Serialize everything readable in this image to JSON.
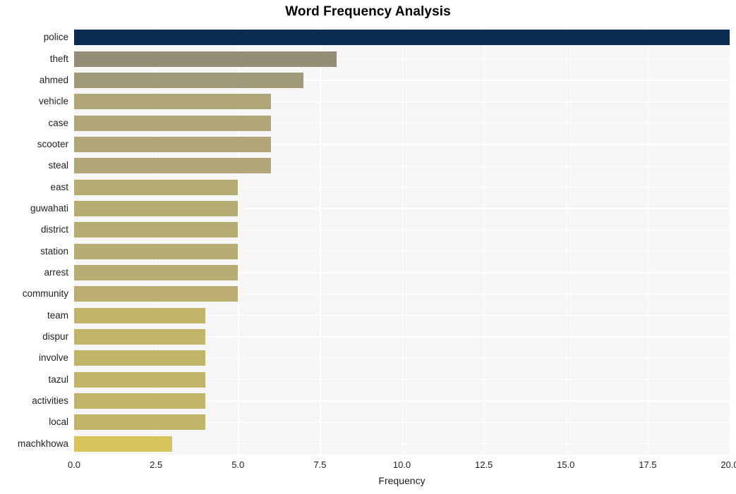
{
  "chart_data": {
    "type": "bar",
    "orientation": "horizontal",
    "title": "Word Frequency Analysis",
    "xlabel": "Frequency",
    "ylabel": "",
    "categories": [
      "police",
      "theft",
      "ahmed",
      "vehicle",
      "case",
      "scooter",
      "steal",
      "east",
      "guwahati",
      "district",
      "station",
      "arrest",
      "community",
      "team",
      "dispur",
      "involve",
      "tazul",
      "activities",
      "local",
      "machkhowa"
    ],
    "values": [
      20,
      8,
      7,
      6,
      6,
      6,
      6,
      5,
      5,
      5,
      5,
      5,
      5,
      4,
      4,
      4,
      4,
      4,
      4,
      3
    ],
    "bar_colors": [
      "#0b2a52",
      "#938c77",
      "#a09a79",
      "#b0a677",
      "#b0a677",
      "#b0a677",
      "#b0a677",
      "#b7ac74",
      "#b7ac74",
      "#b7ac74",
      "#b7ac74",
      "#b7ac74",
      "#bcae72",
      "#c2b56a",
      "#c2b56a",
      "#c2b56a",
      "#c2b56a",
      "#c2b56a",
      "#c2b56a",
      "#d6c55c"
    ],
    "xlim": [
      0.0,
      20.0
    ],
    "xticks": [
      "0.0",
      "2.5",
      "5.0",
      "7.5",
      "10.0",
      "12.5",
      "15.0",
      "17.5",
      "20.0"
    ],
    "xtick_values": [
      0.0,
      2.5,
      5.0,
      7.5,
      10.0,
      12.5,
      15.0,
      17.5,
      20.0
    ],
    "grid": true,
    "grid_color": "#ffffff",
    "plot_background": "#f6f6f6",
    "figure_background": "#ffffff",
    "legend": null
  }
}
